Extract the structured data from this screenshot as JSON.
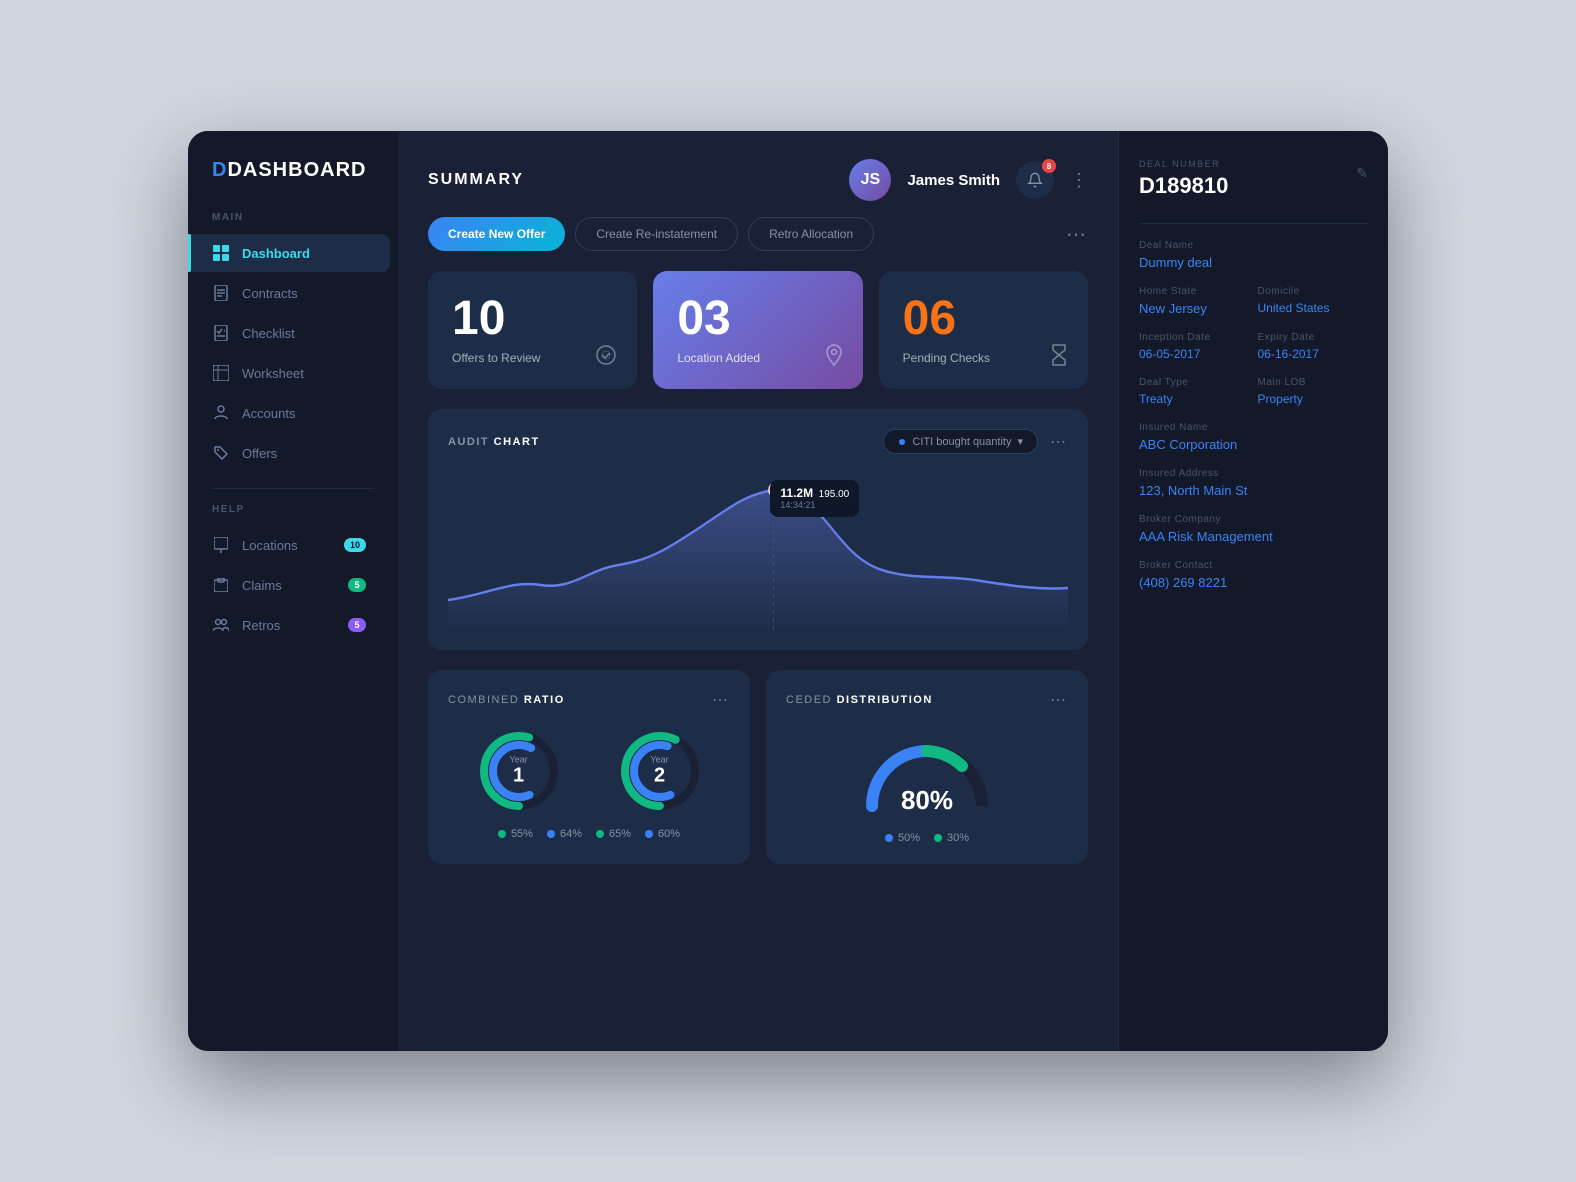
{
  "app": {
    "title": "DASHBOARD",
    "d_letter": "D",
    "page_title": "SUMMARY"
  },
  "sidebar": {
    "main_label": "Main",
    "help_label": "Help",
    "items_main": [
      {
        "id": "dashboard",
        "label": "Dashboard",
        "icon": "⊞",
        "active": true
      },
      {
        "id": "contracts",
        "label": "Contracts",
        "icon": "📄",
        "active": false
      },
      {
        "id": "checklist",
        "label": "Checklist",
        "icon": "☑",
        "active": false
      },
      {
        "id": "worksheet",
        "label": "Worksheet",
        "icon": "📊",
        "active": false
      },
      {
        "id": "accounts",
        "label": "Accounts",
        "icon": "💰",
        "active": false
      },
      {
        "id": "offers",
        "label": "Offers",
        "icon": "🏷",
        "active": false
      }
    ],
    "items_help": [
      {
        "id": "locations",
        "label": "Locations",
        "icon": "📅",
        "badge": "10",
        "badge_color": "cyan"
      },
      {
        "id": "claims",
        "label": "Claims",
        "icon": "🗂",
        "badge": "5",
        "badge_color": "green"
      },
      {
        "id": "retros",
        "label": "Retros",
        "icon": "👤",
        "badge": "5",
        "badge_color": "purple"
      }
    ]
  },
  "header": {
    "user_name": "James Smith",
    "notification_count": "8"
  },
  "action_buttons": [
    {
      "id": "create-offer",
      "label": "Create New Offer",
      "type": "primary"
    },
    {
      "id": "create-reinstatement",
      "label": "Create Re-instatement",
      "type": "outline"
    },
    {
      "id": "retro-allocation",
      "label": "Retro Allocation",
      "type": "outline"
    }
  ],
  "stats": [
    {
      "id": "offers",
      "number": "10",
      "label": "Offers to Review",
      "highlighted": false,
      "number_color": "white"
    },
    {
      "id": "location",
      "number": "03",
      "label": "Location Added",
      "highlighted": true,
      "number_color": "white"
    },
    {
      "id": "pending",
      "number": "06",
      "label": "Pending Checks",
      "highlighted": false,
      "number_color": "orange"
    }
  ],
  "audit_chart": {
    "title_prefix": "AUDIT ",
    "title_main": "CHART",
    "filter_label": "CITI bought quantity",
    "tooltip": {
      "value": "11.2M",
      "secondary": "195.00",
      "time": "14:34:21"
    }
  },
  "combined_ratio": {
    "title_prefix": "COMBINED ",
    "title_main": "RATIO",
    "year1": {
      "label": "Year",
      "number": "1",
      "value1": 55,
      "value2": 64,
      "color1": "#10b981",
      "color2": "#3b82f6"
    },
    "year2": {
      "label": "Year",
      "number": "2",
      "value1": 65,
      "value2": 60,
      "color1": "#10b981",
      "color2": "#3b82f6"
    },
    "legend": [
      {
        "label": "55%",
        "color": "#10b981"
      },
      {
        "label": "64%",
        "color": "#3b82f6"
      },
      {
        "label": "65%",
        "color": "#10b981"
      },
      {
        "label": "60%",
        "color": "#3b82f6"
      }
    ]
  },
  "ceded_distribution": {
    "title_prefix": "CEDED ",
    "title_main": "DISTRIBUTION",
    "percentage": "80%",
    "legend": [
      {
        "label": "50%",
        "color": "#3b82f6"
      },
      {
        "label": "30%",
        "color": "#10b981"
      }
    ]
  },
  "deal": {
    "number_label": "DEAL NUMBER",
    "number": "D189810",
    "fields": [
      {
        "label": "Deal Name",
        "value": "Dummy deal"
      },
      {
        "label": "Home State",
        "value": "New Jersey"
      },
      {
        "label": "Domicile",
        "value": "United States"
      },
      {
        "label": "Inception Date",
        "value": "06-05-2017"
      },
      {
        "label": "Expiry Date",
        "value": "06-16-2017"
      },
      {
        "label": "Deal Type",
        "value": "Treaty"
      },
      {
        "label": "Main LOB",
        "value": "Property"
      },
      {
        "label": "Insured Name",
        "value": "ABC Corporation"
      },
      {
        "label": "Insured Address",
        "value": "123, North Main St"
      },
      {
        "label": "Broker Company",
        "value": "AAA Risk Management"
      },
      {
        "label": "Broker Contact",
        "value": "(408) 269 8221"
      }
    ]
  }
}
